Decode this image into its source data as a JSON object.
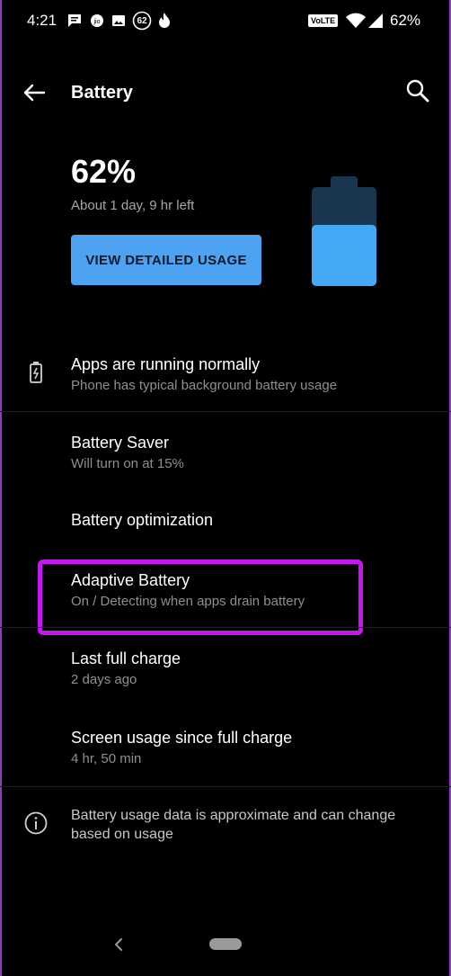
{
  "status_bar": {
    "time": "4:21",
    "badge_number": "62",
    "volte": "VoLTE",
    "battery_percent": "62%"
  },
  "app_bar": {
    "title": "Battery"
  },
  "header": {
    "percent": "62%",
    "time_left": "About 1 day, 9 hr left",
    "button_label": "VIEW DETAILED USAGE",
    "battery_level": 0.62,
    "colors": {
      "battery_fill": "#43a8f6",
      "battery_empty": "#1a3550",
      "button": "#4da2f2"
    }
  },
  "items": [
    {
      "title": "Apps are running normally",
      "subtitle": "Phone has typical background battery usage",
      "icon": "battery-alert-icon"
    },
    {
      "title": "Battery Saver",
      "subtitle": "Will turn on at 15%"
    },
    {
      "title": "Battery optimization",
      "subtitle": ""
    },
    {
      "title": "Adaptive Battery",
      "subtitle": "On / Detecting when apps drain battery"
    },
    {
      "title": "Last full charge",
      "subtitle": "2 days ago"
    },
    {
      "title": "Screen usage since full charge",
      "subtitle": "4 hr, 50 min"
    }
  ],
  "footer": {
    "info_text": "Battery usage data is approximate and can change based on usage",
    "icon": "info-icon"
  },
  "highlight_color": "#c418f0"
}
